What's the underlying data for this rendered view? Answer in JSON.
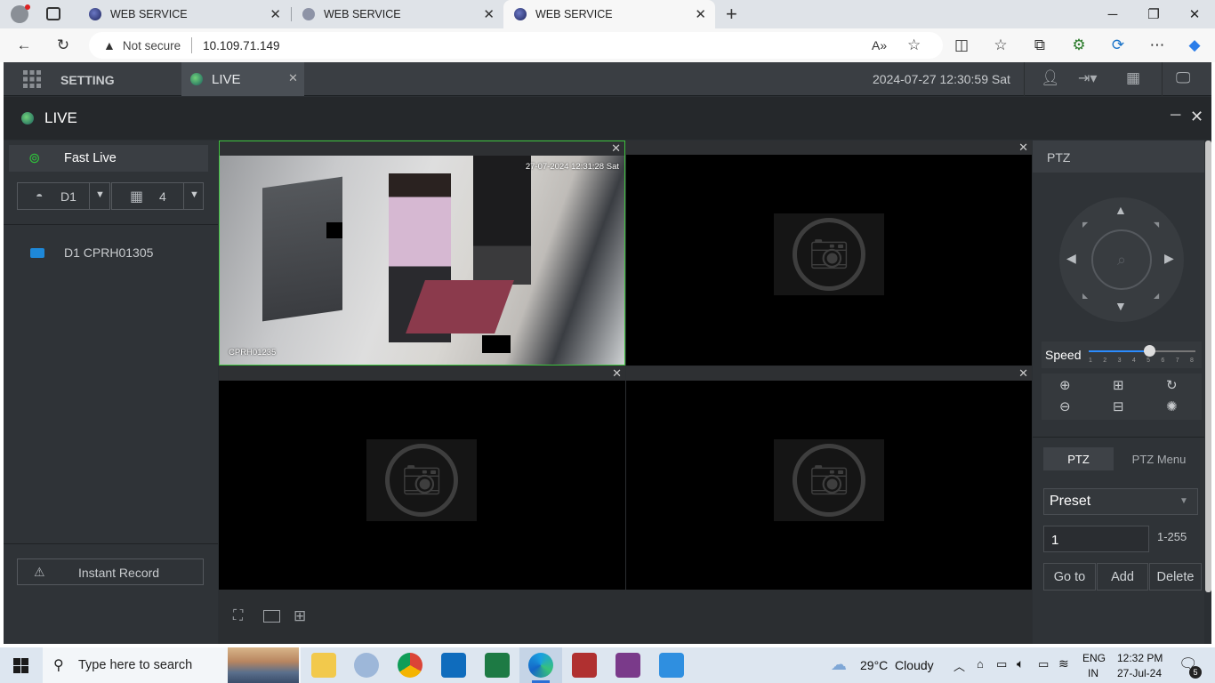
{
  "browser": {
    "tabs": [
      {
        "title": "WEB SERVICE",
        "active": false
      },
      {
        "title": "WEB SERVICE",
        "active": false
      },
      {
        "title": "WEB SERVICE",
        "active": true
      }
    ],
    "security_label": "Not secure",
    "url": "10.109.71.149"
  },
  "app": {
    "setting_label": "SETTING",
    "live_tab_label": "LIVE",
    "datetime": "2024-07-27 12:30:59 Sat",
    "live_title": "LIVE",
    "fast_live_label": "Fast Live",
    "device_select": "D1",
    "split_select": "4",
    "device_item": "D1 CPRH01305",
    "instant_record_label": "Instant Record",
    "camera_osd_time": "27-07-2024 12:31:28 Sat",
    "camera_osd_name": "CPRH01235"
  },
  "ptz": {
    "title": "PTZ",
    "speed_label": "Speed",
    "speed_ticks": [
      "1",
      "2",
      "3",
      "4",
      "5",
      "6",
      "7",
      "8"
    ],
    "speed_value": 5,
    "tabs": [
      "PTZ",
      "PTZ Menu"
    ],
    "mode_select": "Preset",
    "preset_value": "1",
    "preset_range": "1-255",
    "buttons": [
      "Go to",
      "Add",
      "Delete"
    ]
  },
  "taskbar": {
    "search_placeholder": "Type here to search",
    "weather": "29°C  Cloudy",
    "lang_top": "ENG",
    "lang_bottom": "IN",
    "time": "12:32 PM",
    "date": "27-Jul-24",
    "notification_count": "5"
  },
  "colors": {
    "accent_green": "#3ec33e",
    "app_bg": "#2b2f33"
  }
}
